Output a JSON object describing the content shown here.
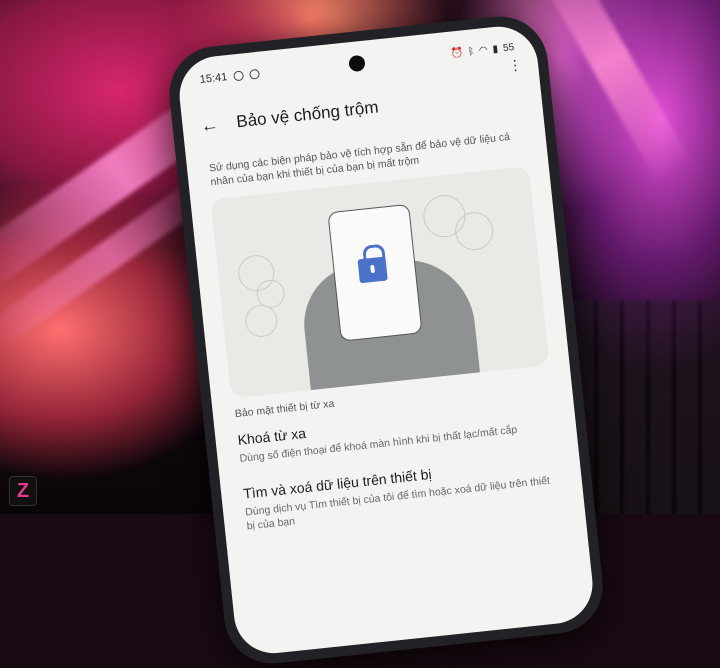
{
  "status_bar": {
    "time": "15:41",
    "battery": "55"
  },
  "header": {
    "back_icon": "back-arrow-icon",
    "title": "Bảo vệ chống trộm",
    "menu_icon": "more-vertical-icon"
  },
  "description": "Sử dụng các biện pháp bảo vệ tích hợp sẵn để bảo vệ dữ liệu cá nhân của bạn khi thiết bị của bạn bị mất trộm",
  "illustration": {
    "icon": "lock-icon",
    "accent": "#4a72c9"
  },
  "section_header": "Bảo mật thiết bị từ xa",
  "settings": [
    {
      "title": "Khoá từ xa",
      "subtitle": "Dùng số điện thoại để khoá màn hình khi bị thất lạc/mất cắp"
    },
    {
      "title": "Tìm và xoá dữ liệu trên thiết bị",
      "subtitle": "Dùng dịch vụ Tìm thiết bị của tôi để tìm hoặc xoá dữ liệu trên thiết bị của bạn"
    }
  ],
  "watermark": "Z"
}
